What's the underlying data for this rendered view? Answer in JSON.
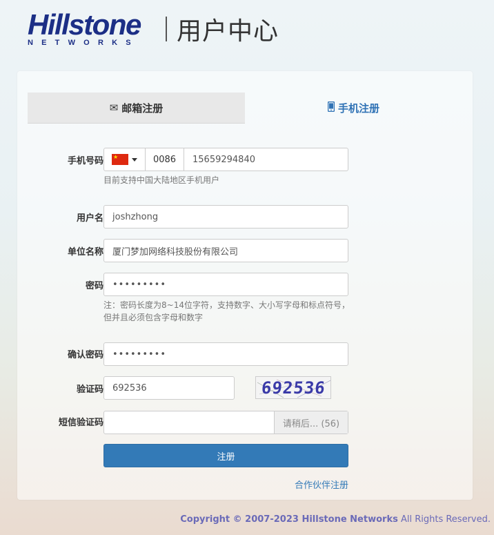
{
  "header": {
    "logo_word": "Hillstone",
    "logo_sub": "NETWORKS",
    "title": "用户中心"
  },
  "tabs": [
    {
      "label": "邮箱注册",
      "icon": "envelope-icon",
      "active": false
    },
    {
      "label": "手机注册",
      "icon": "mobile-phone-icon",
      "active": true
    }
  ],
  "form": {
    "phone": {
      "label": "手机号码",
      "country_flag": "china-flag-icon",
      "country_code": "0086",
      "value": "15659294840",
      "help": "目前支持中国大陆地区手机用户"
    },
    "username": {
      "label": "用户名",
      "value": "joshzhong"
    },
    "company": {
      "label": "单位名称",
      "value": "厦门梦加网络科技股份有限公司"
    },
    "password": {
      "label": "密码",
      "value": "•••••••••",
      "help": "注：密码长度为8~14位字符，支持数字、大小写字母和标点符号，但并且必须包含字母和数字"
    },
    "confirm_password": {
      "label": "确认密码",
      "value": "•••••••••"
    },
    "captcha": {
      "label": "验证码",
      "value": "692536",
      "image_text": "692536"
    },
    "sms_code": {
      "label": "短信验证码",
      "value": "",
      "button_label": "请稍后... (56)"
    },
    "submit_label": "注册",
    "partner_link": "合作伙伴注册"
  },
  "footer": {
    "copyright": "Copyright © 2007-2023 Hillstone Networks",
    "rights": " All Rights Reserved."
  },
  "colors": {
    "brand_blue": "#1c2f86",
    "primary_button": "#337ab7",
    "active_tab_text": "#2f72b5"
  }
}
